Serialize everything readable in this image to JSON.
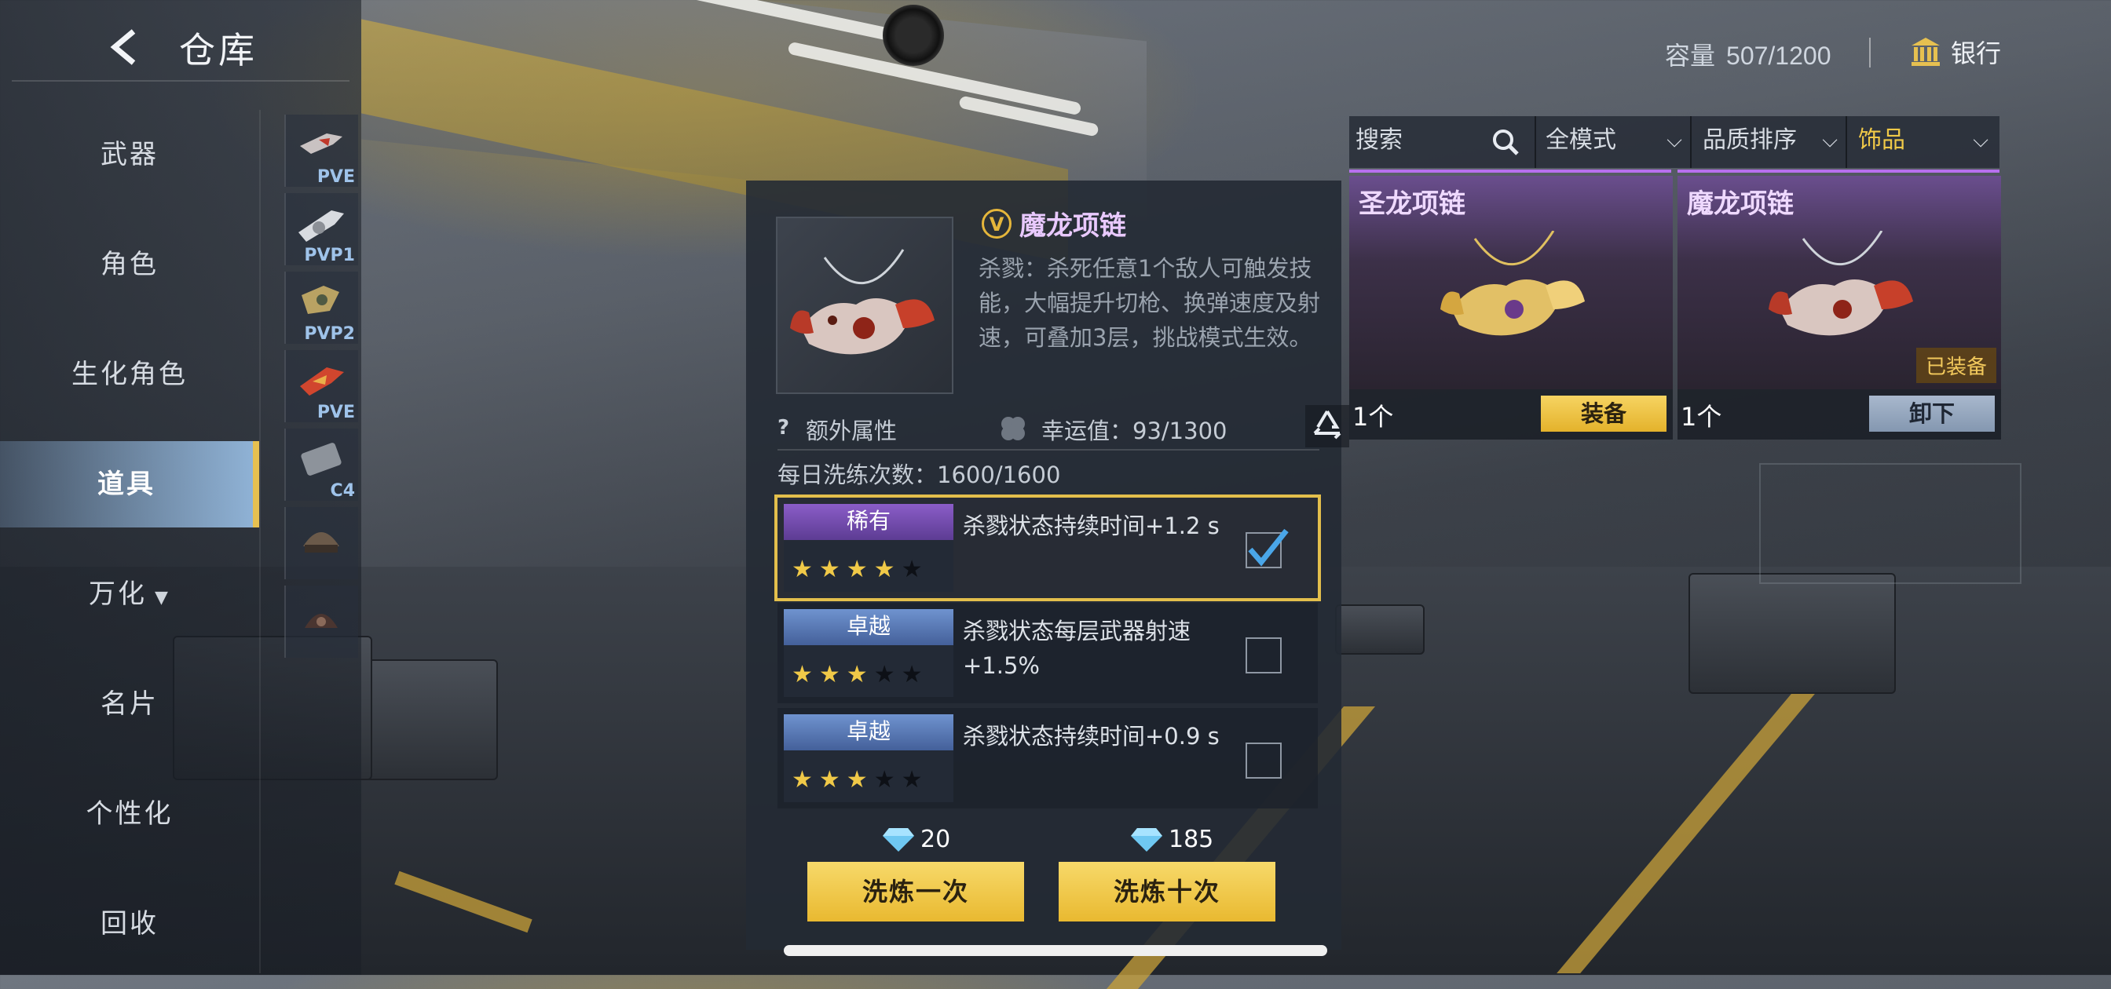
{
  "header": {
    "title": "仓库",
    "capacity_label": "容量",
    "capacity_value": "507/1200",
    "bank_label": "银行"
  },
  "nav": {
    "items": [
      {
        "label": "武器"
      },
      {
        "label": "角色"
      },
      {
        "label": "生化角色"
      },
      {
        "label": "道具",
        "active": true
      },
      {
        "label": "万化",
        "has_caret": true
      },
      {
        "label": "名片"
      },
      {
        "label": "个性化"
      },
      {
        "label": "回收"
      }
    ],
    "sub_items": [
      {
        "label": "PVE"
      },
      {
        "label": "PVP1"
      },
      {
        "label": "PVP2"
      },
      {
        "label": "PVE"
      },
      {
        "label": "C4"
      },
      {
        "label": ""
      },
      {
        "label": ""
      }
    ]
  },
  "detail": {
    "badge": "V",
    "name": "魔龙项链",
    "description": "杀戮：杀死任意1个敌人可触发技能，大幅提升切枪、换弹速度及射速，可叠加3层，挑战模式生效。",
    "extra_attr_label": "额外属性",
    "luck_label": "幸运值：93/1300",
    "daily_label": "每日洗练次数：",
    "daily_value": "1600/1600",
    "options": [
      {
        "rank": "稀有",
        "stars": 4,
        "max_stars": 5,
        "text": "杀戮状态持续时间+1.2 s",
        "checked": true
      },
      {
        "rank": "卓越",
        "stars": 3,
        "max_stars": 5,
        "text": "杀戮状态每层武器射速+1.5%",
        "checked": false
      },
      {
        "rank": "卓越",
        "stars": 3,
        "max_stars": 5,
        "text": "杀戮状态持续时间+0.9 s",
        "checked": false
      }
    ],
    "cost_once": "20",
    "cost_ten": "185",
    "btn_once": "洗炼一次",
    "btn_ten": "洗炼十次"
  },
  "filters": {
    "search_label": "搜索",
    "mode": "全模式",
    "sort": "品质排序",
    "category": "饰品"
  },
  "cards": [
    {
      "name": "圣龙项链",
      "qty": "1个",
      "action": "装备",
      "equipped": false
    },
    {
      "name": "魔龙项链",
      "qty": "1个",
      "action": "卸下",
      "equipped": true,
      "equipped_label": "已装备"
    }
  ],
  "colors": {
    "accent_yellow": "#e9b930",
    "rare_purple": "#8b5dc8",
    "epic_blue": "#6f93cf",
    "name_purple": "#e9c9ff"
  }
}
